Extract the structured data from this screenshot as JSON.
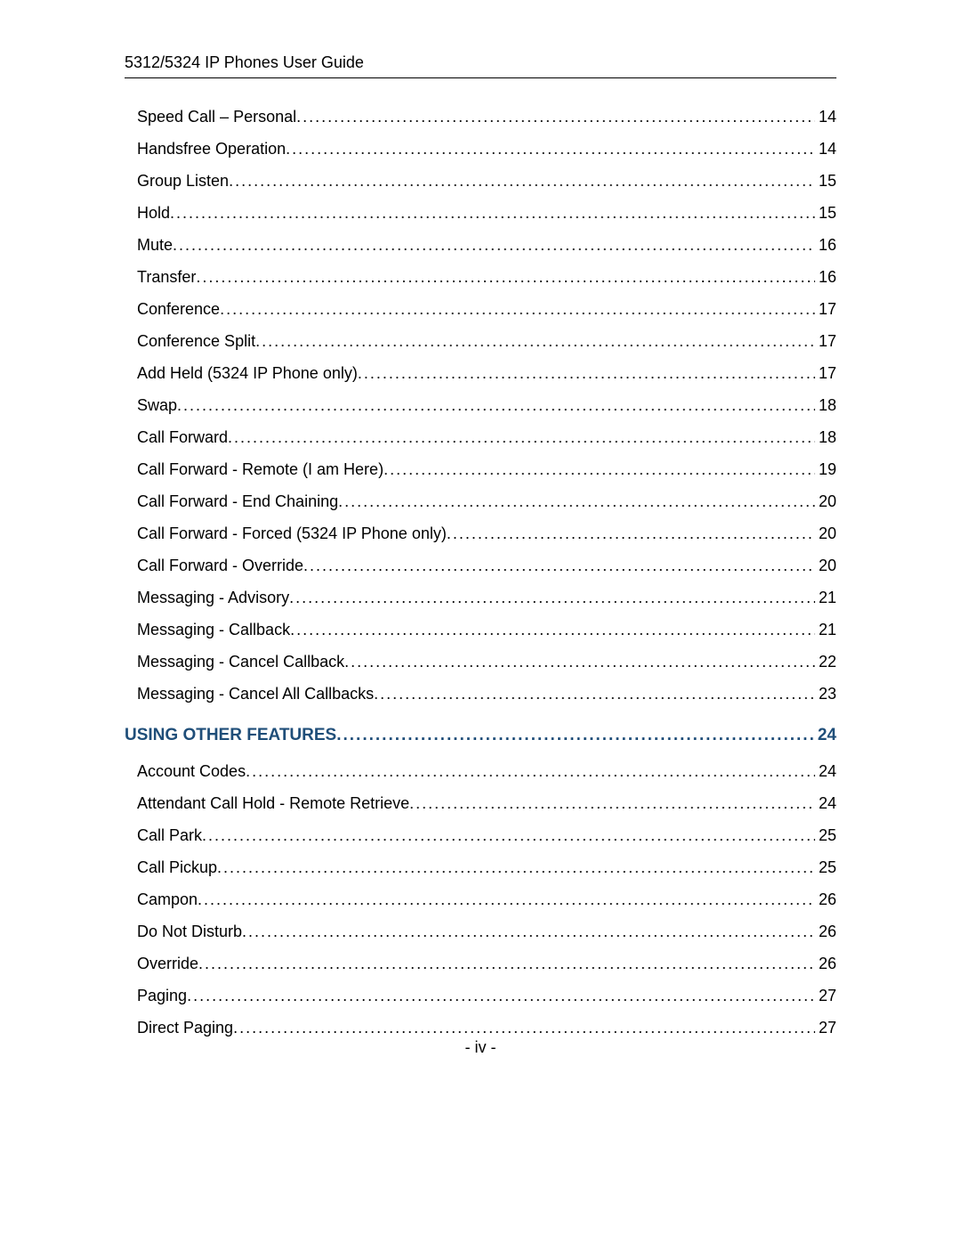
{
  "header": {
    "title": "5312/5324 IP Phones User Guide"
  },
  "leader_fill": "..................................................................................................................................................................................................................................................",
  "toc": [
    {
      "level": 1,
      "title": "Speed Call – Personal",
      "page": "14"
    },
    {
      "level": 1,
      "title": "Handsfree Operation",
      "page": "14"
    },
    {
      "level": 1,
      "title": "Group Listen",
      "page": "15"
    },
    {
      "level": 1,
      "title": "Hold",
      "page": "15"
    },
    {
      "level": 1,
      "title": "Mute",
      "page": "16"
    },
    {
      "level": 1,
      "title": "Transfer",
      "page": "16"
    },
    {
      "level": 1,
      "title": "Conference",
      "page": "17"
    },
    {
      "level": 1,
      "title": "Conference Split",
      "page": "17"
    },
    {
      "level": 1,
      "title": "Add Held (5324 IP Phone only)",
      "page": "17"
    },
    {
      "level": 1,
      "title": "Swap",
      "page": "18"
    },
    {
      "level": 1,
      "title": "Call Forward",
      "page": "18"
    },
    {
      "level": 1,
      "title": "Call Forward - Remote (I am Here)",
      "page": "19"
    },
    {
      "level": 1,
      "title": "Call Forward - End Chaining",
      "page": "20"
    },
    {
      "level": 1,
      "title": "Call Forward - Forced (5324 IP Phone only)",
      "page": "20"
    },
    {
      "level": 1,
      "title": "Call Forward - Override",
      "page": "20"
    },
    {
      "level": 1,
      "title": "Messaging - Advisory",
      "page": "21"
    },
    {
      "level": 1,
      "title": "Messaging - Callback",
      "page": "21"
    },
    {
      "level": 1,
      "title": "Messaging - Cancel Callback",
      "page": "22"
    },
    {
      "level": 1,
      "title": "Messaging - Cancel All Callbacks",
      "page": "23"
    },
    {
      "level": 0,
      "title": "USING OTHER FEATURES",
      "page": "24"
    },
    {
      "level": 1,
      "title": "Account Codes",
      "page": "24"
    },
    {
      "level": 1,
      "title": "Attendant Call Hold - Remote Retrieve",
      "page": "24"
    },
    {
      "level": 1,
      "title": "Call Park",
      "page": "25"
    },
    {
      "level": 1,
      "title": "Call Pickup",
      "page": "25"
    },
    {
      "level": 1,
      "title": "Campon",
      "page": "26"
    },
    {
      "level": 1,
      "title": "Do Not Disturb",
      "page": "26"
    },
    {
      "level": 1,
      "title": "Override",
      "page": "26"
    },
    {
      "level": 1,
      "title": "Paging",
      "page": "27"
    },
    {
      "level": 1,
      "title": "Direct Paging",
      "page": "27"
    }
  ],
  "footer": {
    "page_label": "- iv -"
  }
}
